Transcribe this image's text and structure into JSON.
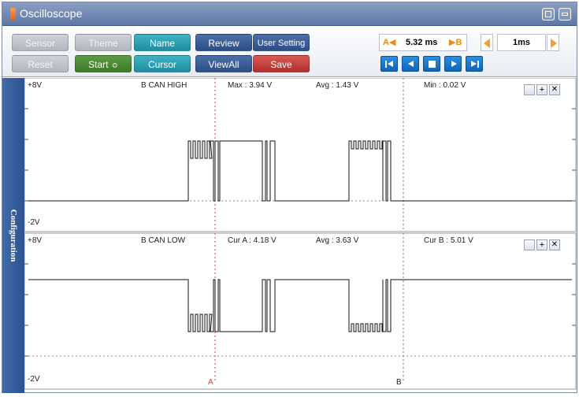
{
  "window": {
    "title": "Oscilloscope"
  },
  "toolbar": {
    "row1": [
      {
        "label": "Sensor",
        "style": "gray"
      },
      {
        "label": "Theme",
        "style": "gray"
      },
      {
        "label": "Name",
        "style": "teal"
      },
      {
        "label": "Review",
        "style": "navy"
      },
      {
        "label": "User Setting",
        "style": "navy"
      }
    ],
    "row2": [
      {
        "label": "Reset",
        "style": "gray"
      },
      {
        "label": "Start",
        "style": "green"
      },
      {
        "label": "Cursor",
        "style": "teal"
      },
      {
        "label": "ViewAll",
        "style": "navy"
      },
      {
        "label": "Save",
        "style": "red"
      }
    ],
    "cursor_a_label": "A◀",
    "cursor_delta": "5.32 ms",
    "cursor_b_label": "▶B",
    "timebase": "1ms",
    "start_spin_glyph": "≎"
  },
  "side": {
    "label": "Configuration"
  },
  "channels": [
    {
      "name": "B CAN HIGH",
      "top_label": "+8V",
      "bottom_label": "-2V",
      "stat1": "Max : 3.94 V",
      "stat2": "Avg : 1.43 V",
      "stat3": "Min : 0.02 V"
    },
    {
      "name": "B CAN LOW",
      "top_label": "+8V",
      "bottom_label": "-2V",
      "stat1": "Cur A : 4.18 V",
      "stat2": "Avg : 3.63 V",
      "stat3": "Cur B : 5.01 V"
    }
  ],
  "cursors": {
    "a": "A",
    "b": "B"
  },
  "colors": {
    "accent": "#2d5390",
    "cursor_a": "#e0403a",
    "trace": "#111111"
  }
}
